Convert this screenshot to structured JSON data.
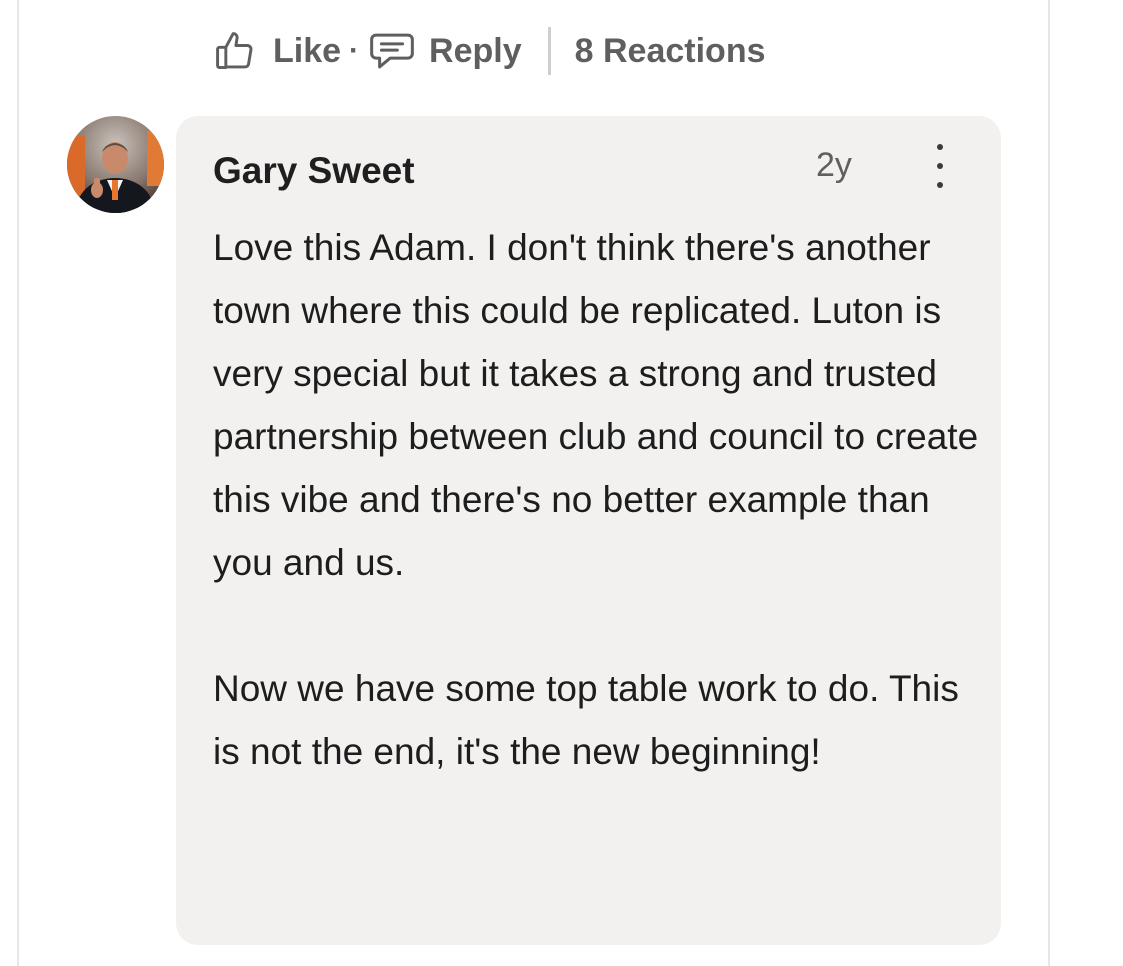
{
  "actions": {
    "like_label": "Like",
    "dot": "·",
    "reply_label": "Reply",
    "reactions_label": "8 Reactions"
  },
  "comment": {
    "author": "Gary Sweet",
    "time": "2y",
    "paragraphs": [
      "Love this Adam. I don't think there's another town where this could be replicated. Luton is very special but it takes a strong and trusted partnership between club and council to create this vibe and there's no better example than you and us.",
      "Now we have some top table work to do. This is not the end, it's the new beginning!"
    ]
  },
  "icons": {
    "like": "thumbs-up-outline",
    "reply": "speech-bubble-outline",
    "more": "vertical-ellipsis"
  },
  "colors": {
    "bubble_bg": "#f2f1f0",
    "muted_text": "#5f5f5f",
    "accent_orange": "#e8772e"
  }
}
